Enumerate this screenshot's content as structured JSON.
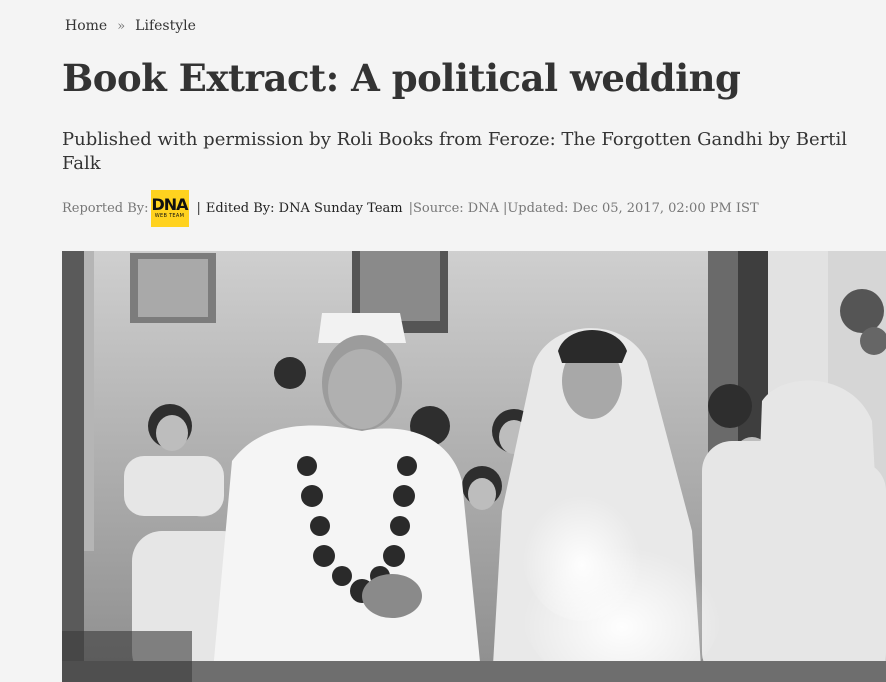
{
  "breadcrumb": {
    "home": "Home",
    "separator": "»",
    "section": "Lifestyle"
  },
  "article": {
    "title": "Book Extract: A political wedding",
    "subtitle": "Published with permission by Roli Books from Feroze: The Forgotten Gandhi by Bertil Falk",
    "byline": {
      "reported_by_label": "Reported By:",
      "logo_text": "DNA",
      "logo_subtext": "WEB TEAM",
      "pipe": "|",
      "edited_by": "Edited By: DNA Sunday Team",
      "source": "|Source: DNA",
      "updated": "|Updated: Dec 05, 2017, 02:00 PM IST"
    }
  },
  "colors": {
    "background": "#f4f4f4",
    "text": "#333333",
    "muted": "#777777",
    "logo_yellow": "#ffd21f"
  }
}
